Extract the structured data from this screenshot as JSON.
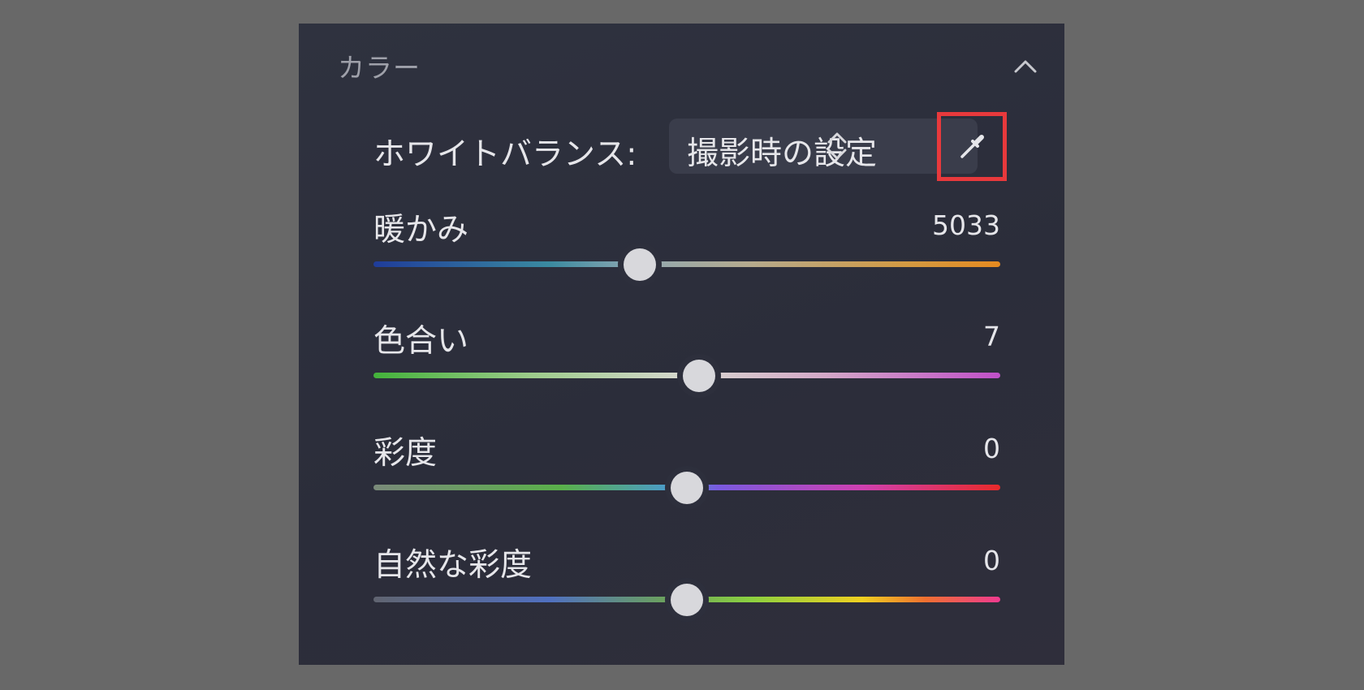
{
  "panel": {
    "title": "カラー",
    "collapse_icon": "chevron-up-icon"
  },
  "white_balance": {
    "label": "ホワイトバランス:",
    "selected_value": "撮影時の設定",
    "selector_icon": "up-down-chevron-icon",
    "eyedropper_icon": "eyedropper-icon",
    "highlight_color": "#e8393c"
  },
  "sliders": [
    {
      "label": "暖かみ",
      "value": "5033",
      "position": 0.425
    },
    {
      "label": "色合い",
      "value": "7",
      "position": 0.52
    },
    {
      "label": "彩度",
      "value": "0",
      "position": 0.5
    },
    {
      "label": "自然な彩度",
      "value": "0",
      "position": 0.5
    }
  ]
}
